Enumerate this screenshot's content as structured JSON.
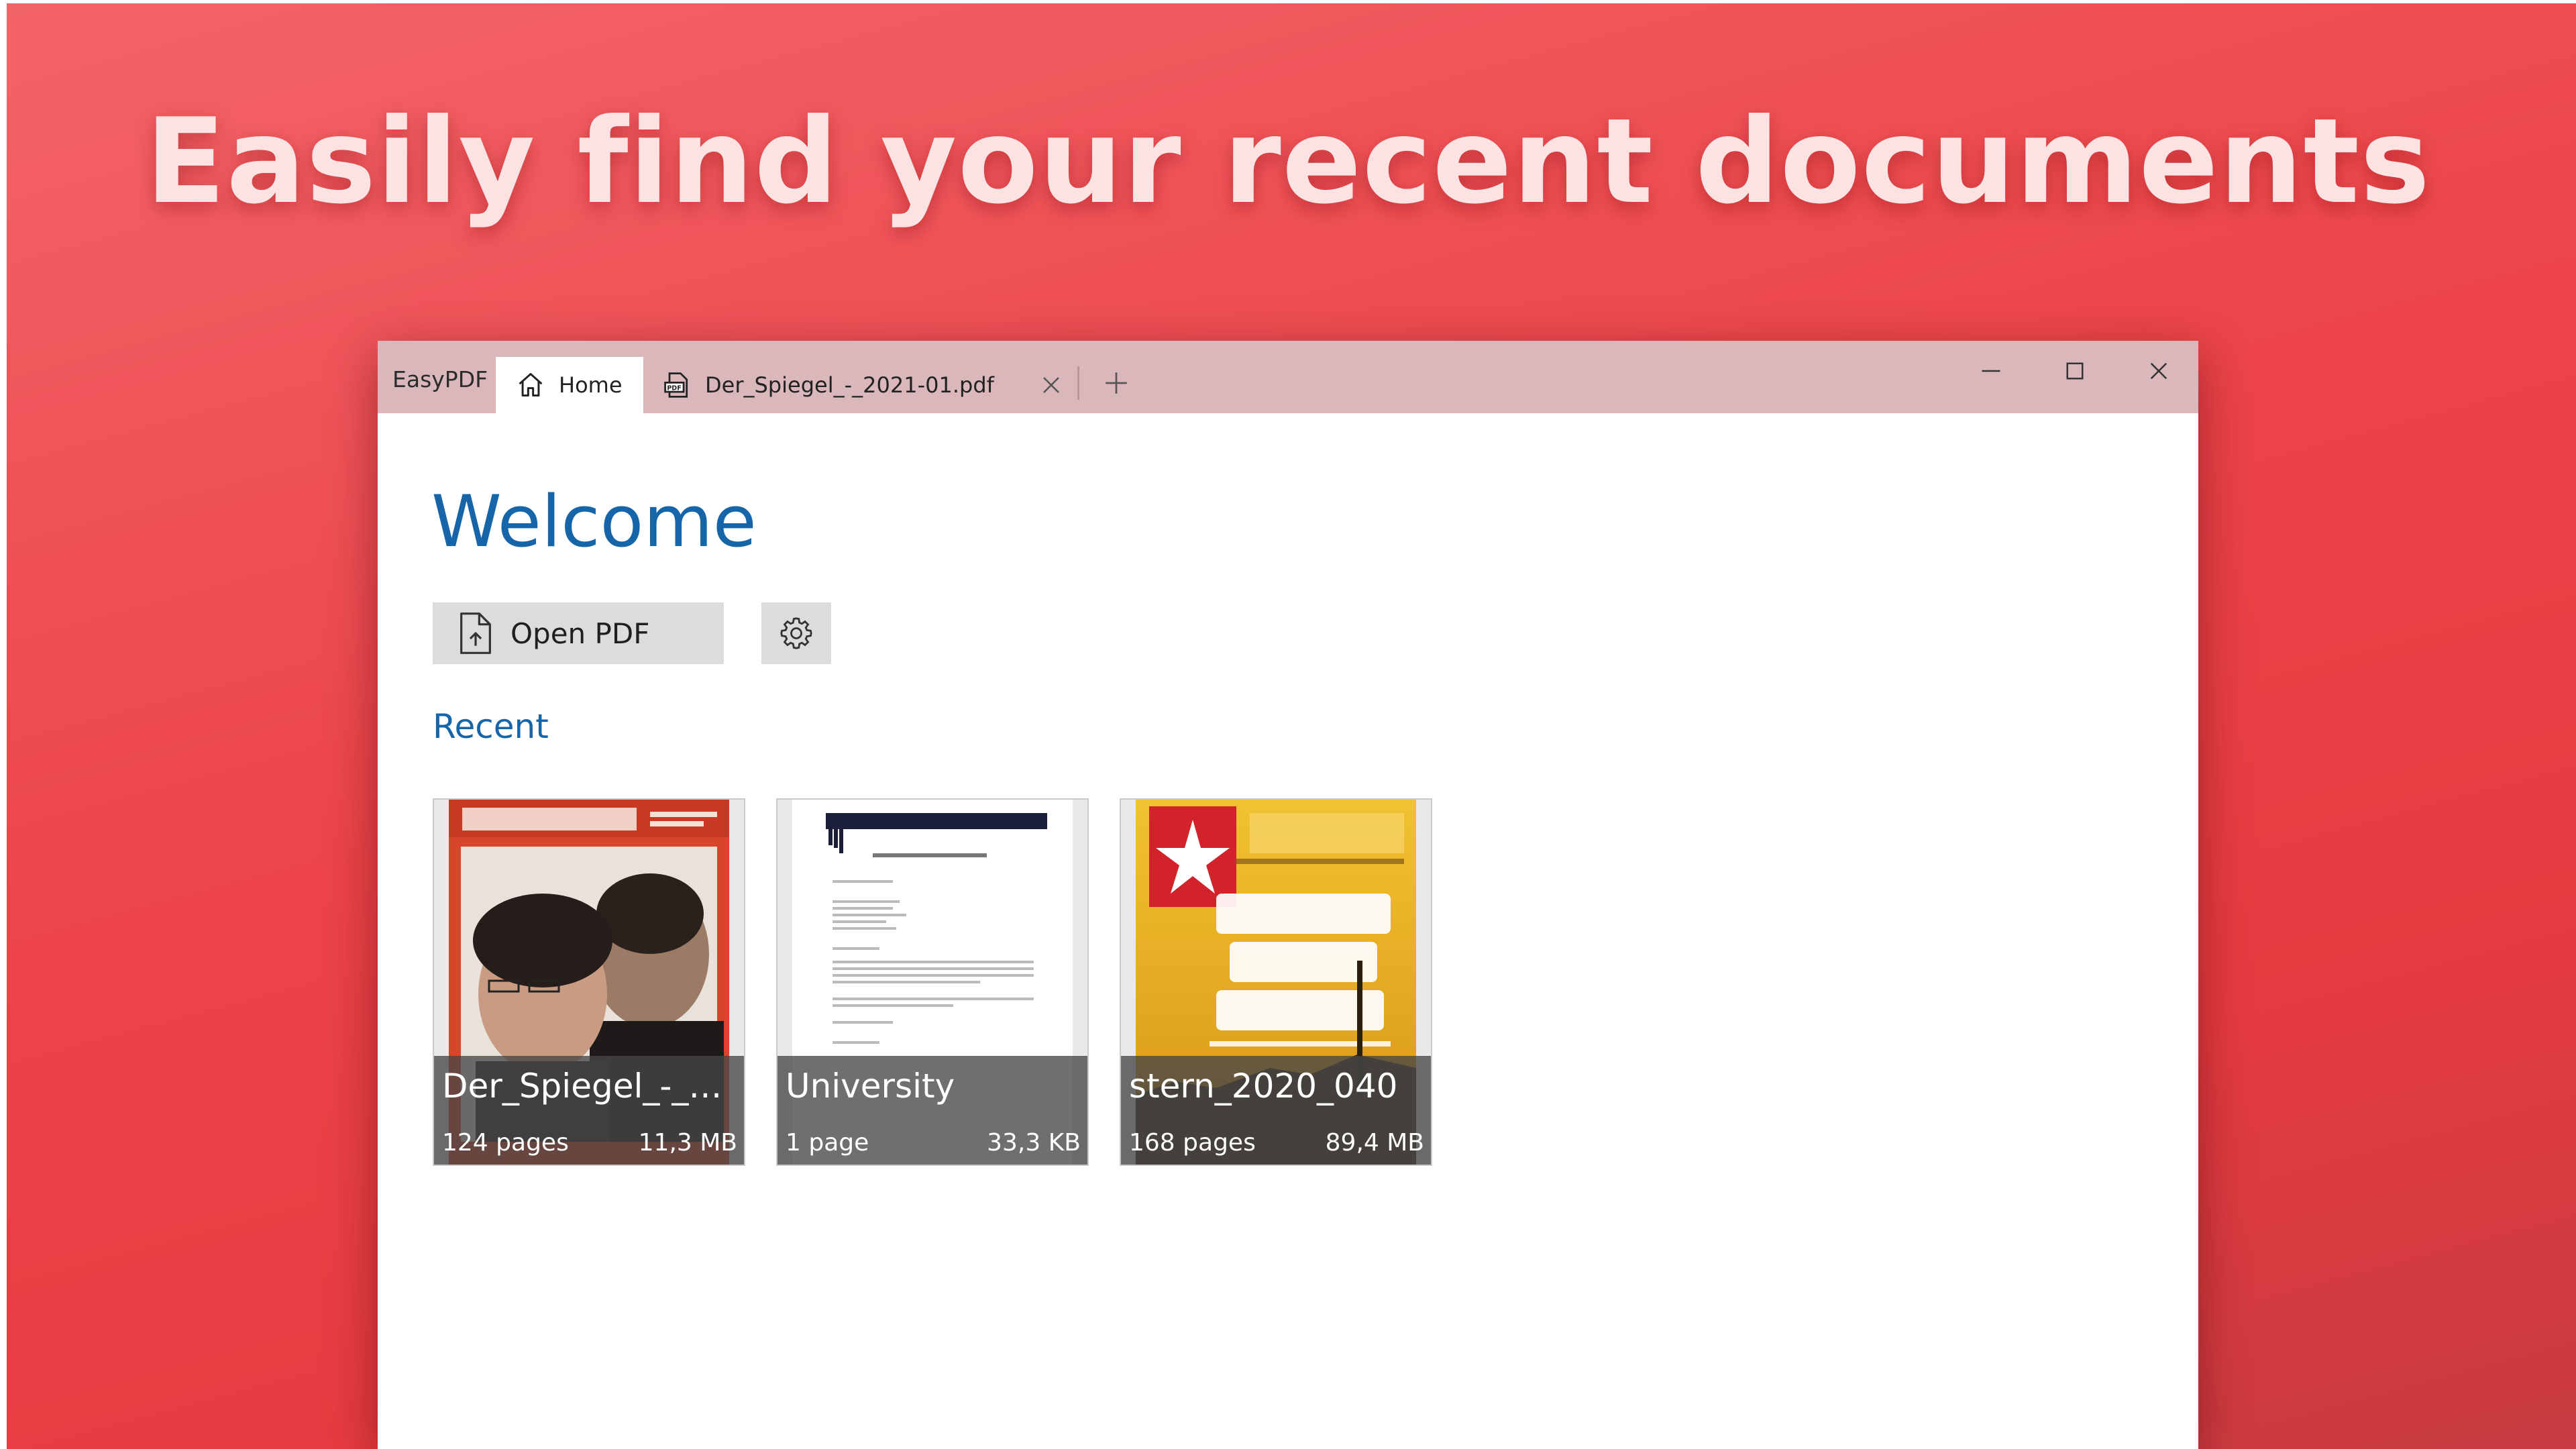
{
  "headline": "Easily find your recent documents",
  "window": {
    "app_name": "EasyPDF",
    "tabs": [
      {
        "label": "Home",
        "icon": "home-icon",
        "active": true
      },
      {
        "label": "Der_Spiegel_-_2021-01.pdf",
        "icon": "pdf-icon",
        "active": false
      }
    ],
    "controls": [
      "minimize-icon",
      "maximize-icon",
      "close-icon"
    ]
  },
  "main": {
    "welcome": "Welcome",
    "open_pdf_label": "Open PDF",
    "settings_icon": "gear-icon",
    "recent_title": "Recent"
  },
  "recent": [
    {
      "name": "Der_Spiegel_-_2...",
      "pages": "124 pages",
      "size": "11,3 MB"
    },
    {
      "name": "University",
      "pages": "1 page",
      "size": "33,3 KB"
    },
    {
      "name": "stern_2020_040",
      "pages": "168 pages",
      "size": "89,4 MB"
    }
  ],
  "colors": {
    "accent": "#1565a8",
    "background": "#ec4449",
    "titlebar": "#d9b7ba",
    "button": "#dcdcdc"
  }
}
